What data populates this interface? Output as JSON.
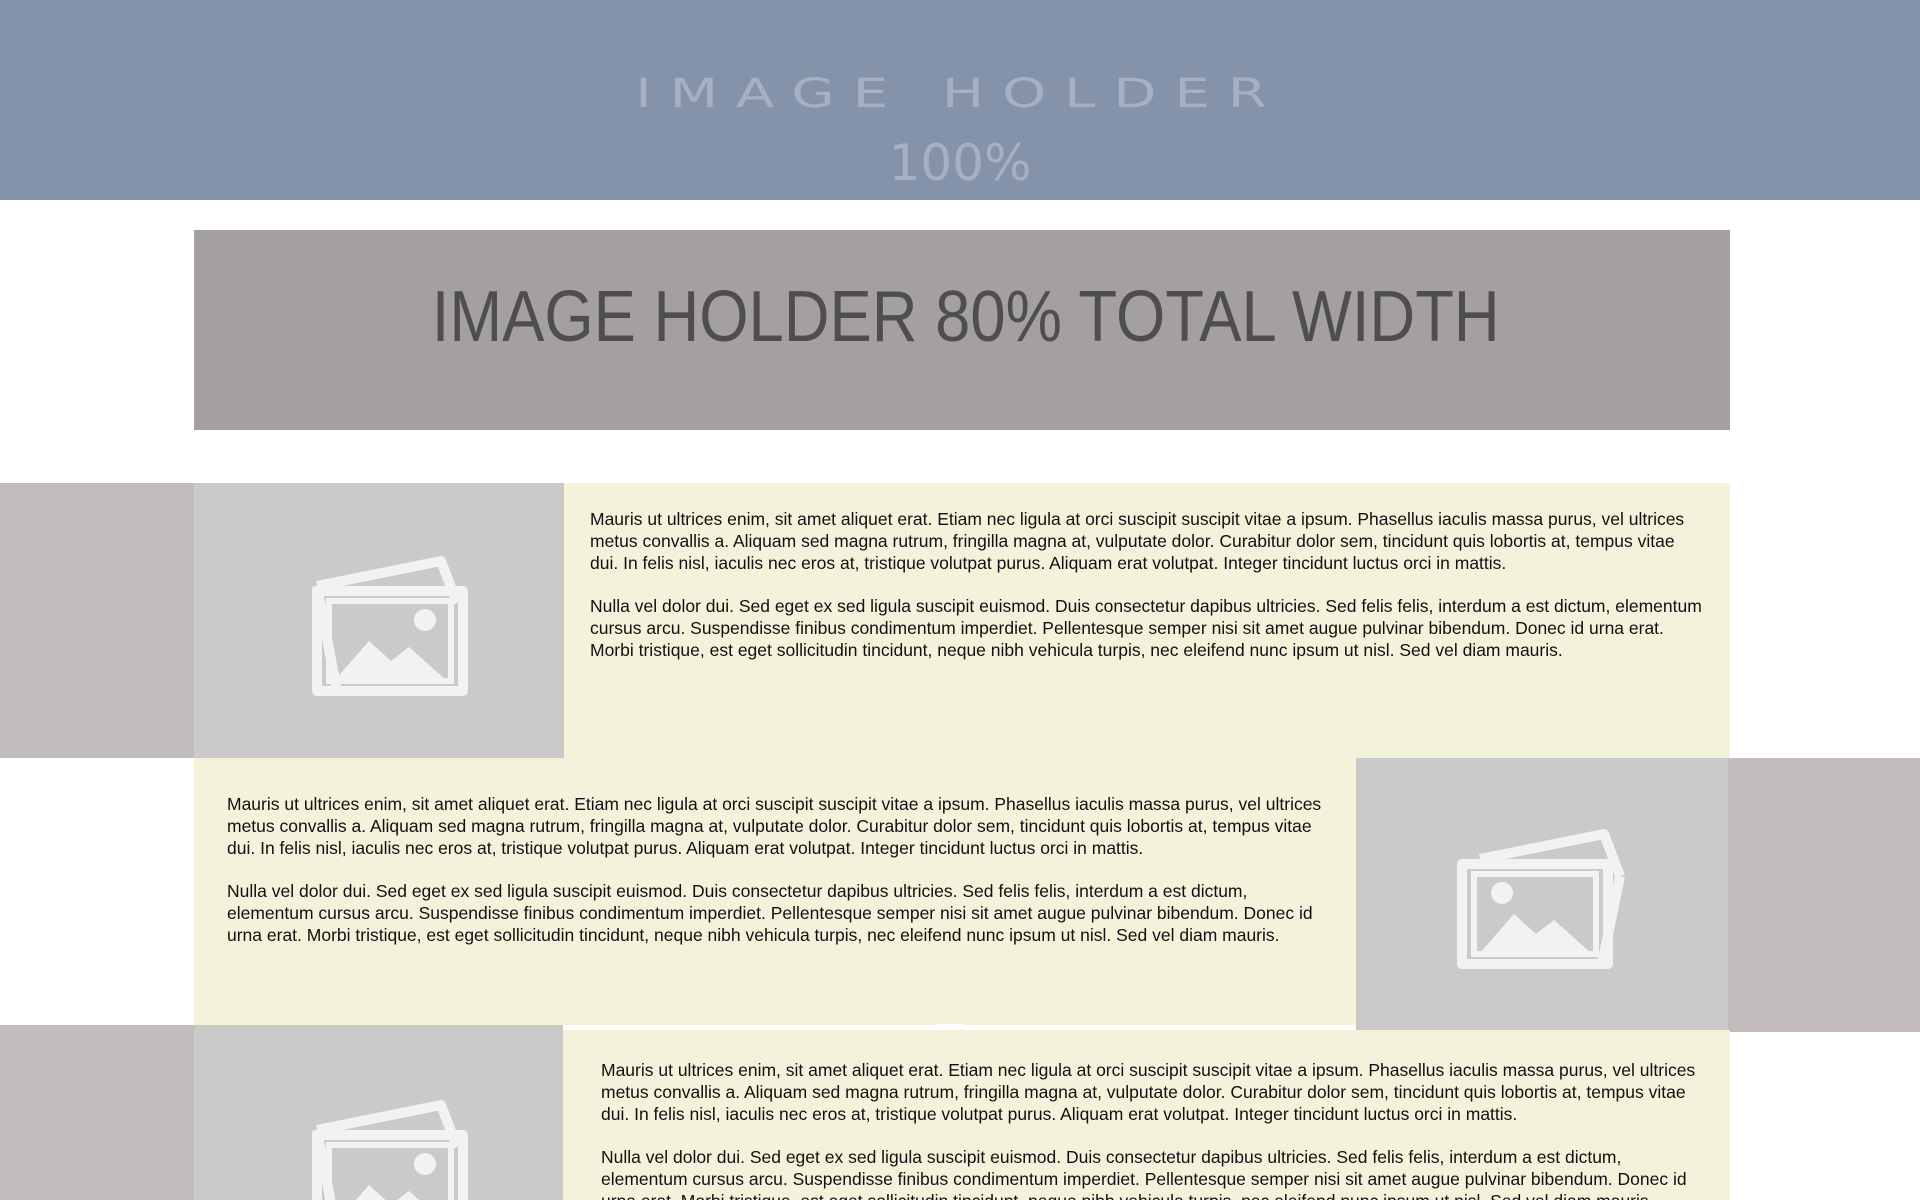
{
  "banner_full": {
    "title": "IMAGE HOLDER",
    "subtitle": "100%",
    "color": "#8593aa"
  },
  "banner_80": {
    "title": "IMAGE HOLDER 80% TOTAL WIDTH",
    "color": "#a4a09f"
  },
  "rows": [
    {
      "image_icon": "image-gallery-icon",
      "paragraphs": [
        "Mauris ut ultrices enim, sit amet aliquet erat. Etiam nec ligula at orci suscipit suscipit vitae a ipsum. Phasellus iaculis massa purus, vel ultrices metus convallis a. Aliquam sed magna rutrum, fringilla magna at, vulputate dolor. Curabitur dolor sem, tincidunt quis lobortis at, tempus vitae dui. In felis nisl, iaculis nec eros at, tristique volutpat purus. Aliquam erat volutpat. Integer tincidunt luctus orci in mattis.",
        "Nulla vel dolor dui. Sed eget ex sed ligula suscipit euismod.  Duis consectetur dapibus ultricies. Sed felis felis, interdum a est dictum, elementum cursus arcu. Suspendisse finibus condimentum imperdiet. Pellentesque semper nisi sit amet augue pulvinar bibendum. Donec id urna erat. Morbi tristique, est eget sollicitudin tincidunt, neque nibh vehicula turpis, nec eleifend nunc ipsum ut nisl. Sed vel diam mauris."
      ]
    },
    {
      "image_icon": "image-gallery-icon",
      "paragraphs": [
        "Mauris ut ultrices enim, sit amet aliquet erat. Etiam nec ligula at orci suscipit suscipit vitae a ipsum. Phasellus iaculis massa purus, vel ultrices metus convallis a. Aliquam sed magna rutrum, fringilla magna at, vulputate dolor. Curabitur dolor sem, tincidunt quis lobortis at, tempus vitae dui. In felis nisl, iaculis nec eros at, tristique volutpat purus. Aliquam erat volutpat. Integer tincidunt luctus orci in mattis.",
        "Nulla vel dolor dui. Sed eget ex sed ligula suscipit euismod.  Duis consectetur dapibus ultricies. Sed felis felis, interdum a est dictum, elementum cursus arcu. Suspendisse finibus condimentum imperdiet. Pellentesque semper nisi sit amet augue pulvinar bibendum. Donec id urna erat. Morbi tristique, est eget sollicitudin tincidunt, neque nibh vehicula turpis, nec eleifend nunc ipsum ut nisl. Sed vel diam mauris."
      ]
    },
    {
      "image_icon": "image-gallery-icon",
      "paragraphs": [
        "Mauris ut ultrices enim, sit amet aliquet erat. Etiam nec ligula at orci suscipit suscipit vitae a ipsum. Phasellus iaculis massa purus, vel ultrices metus convallis a. Aliquam sed magna rutrum, fringilla magna at, vulputate dolor. Curabitur dolor sem, tincidunt quis lobortis at, tempus vitae dui. In felis nisl, iaculis nec eros at, tristique volutpat purus. Aliquam erat volutpat. Integer tincidunt luctus orci in mattis.",
        "Nulla vel dolor dui. Sed eget ex sed ligula suscipit euismod.  Duis consectetur dapibus ultricies. Sed felis felis, interdum a est dictum, elementum cursus arcu. Suspendisse finibus condimentum imperdiet. Pellentesque semper nisi sit amet augue pulvinar bibendum. Donec id urna erat. Morbi tristique, est eget sollicitudin tincidunt, neque nibh vehicula turpis, nec eleifend nunc ipsum ut nisl. Sed vel diam mauris."
      ]
    }
  ],
  "colors": {
    "text_panel": "#f4f2db",
    "image_placeholder": "#cacaca",
    "side_block": "#c2bcbd"
  }
}
